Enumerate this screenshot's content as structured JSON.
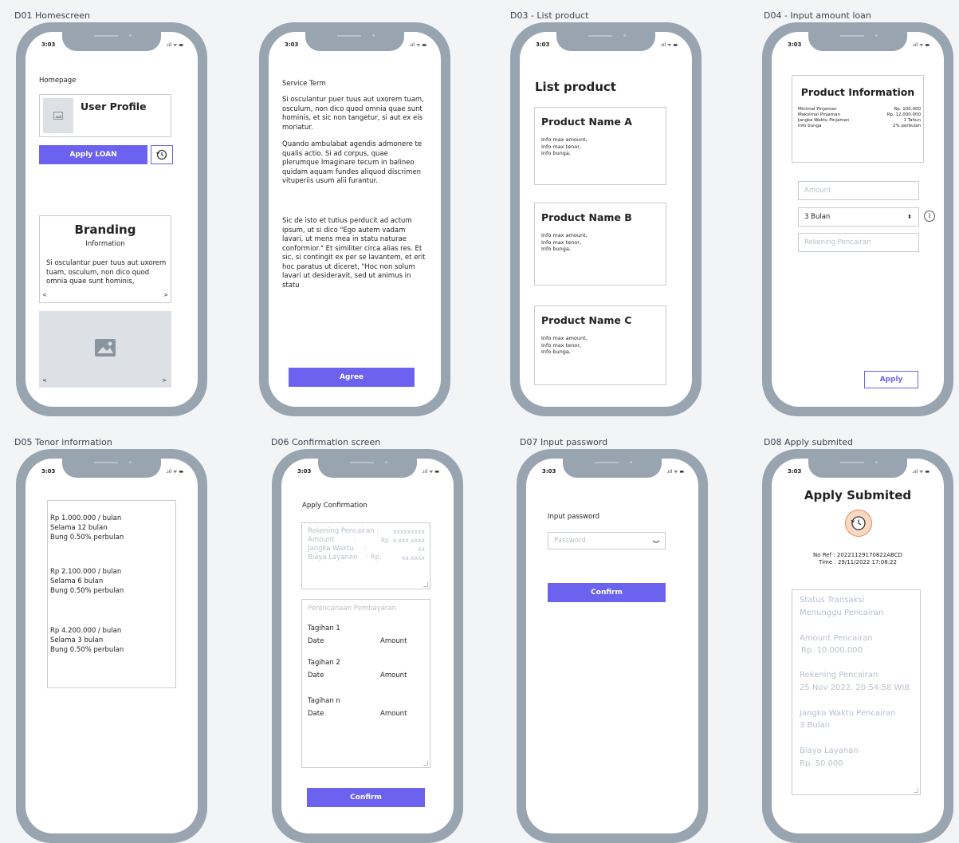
{
  "frames": {
    "d01": "D01 Homescreen",
    "d03": "D03 - List product",
    "d04": "D04 - Input amount loan",
    "d05": "D05 Tenor information",
    "d06": "D06 Confirmation screen",
    "d07": "D07 Input password",
    "d08": "D08 Apply submited"
  },
  "status": {
    "time": "3:03",
    "signal": ".ııl ᯤ ▬"
  },
  "d01": {
    "title": "Homepage",
    "profile": "User Profile",
    "apply_btn": "Apply LOAN",
    "history_icon": "history-icon",
    "branding_title": "Branding",
    "branding_sub": "Information",
    "branding_text": "Si osculantur puer tuus aut uxorem tuam, osculum, non dico quod omnia quae sunt hominis,",
    "prev": "<",
    "next": ">"
  },
  "d02": {
    "title": "Service Term",
    "p1": "Si osculantur puer tuus aut uxorem tuam, osculum, non dico quod omnia quae sunt hominis, et sic non tangetur, si aut ex eis moriatur.",
    "p2": "Quando ambulabat agendis admonere te qualis actio. Si ad corpus, quae plerumque Imaginare tecum in balineo quidam aquam fundes aliquod discrimen vituperiis usum alii furantur.",
    "p3": "Sic de isto et tutius perducit ad actum ipsum, ut si dico \"Ego autem vadam lavari, ut mens mea in statu naturae conformior.\" Et similiter circa alias res. Et sic, si contingit ex per se lavantem, et erit hoc paratus ut diceret, \"Hoc non solum lavari ut desideravit, sed ut animus in statu",
    "agree": "Agree"
  },
  "d03": {
    "title": "List product",
    "products": [
      {
        "name": "Product Name A",
        "l1": "Info max amount,",
        "l2": "Info max tenor,",
        "l3": "Info bunga,"
      },
      {
        "name": "Product Name B",
        "l1": "Info max amount,",
        "l2": "Info max tenor,",
        "l3": "Info bunga,"
      },
      {
        "name": "Product Name C",
        "l1": "Info max amount,",
        "l2": "Info max tenor,",
        "l3": "Info bunga,"
      }
    ]
  },
  "d04": {
    "title": "Product Information",
    "rows": [
      {
        "k": "Minimal Pinjaman",
        "v": "Rp. 100.000"
      },
      {
        "k": "Maksimal Pinjaman",
        "v": "Rp. 12,000.000"
      },
      {
        "k": "Jangka Waktu Pinjaman",
        "v": "1 Tahun"
      },
      {
        "k": "Info bunga",
        "v": "2% perbulan"
      }
    ],
    "amount_ph": "Amount",
    "tenor": "3 Bulan",
    "rek_ph": "Rekening Pencairan",
    "apply": "Apply"
  },
  "d05": {
    "items": [
      {
        "a": "Rp 1.000.000 / bulan",
        "b": "Selama 12 bulan",
        "c": "Bung 0.50% perbulan"
      },
      {
        "a": "Rp 2.100.000 / bulan",
        "b": "Selama 6 bulan",
        "c": "Bung 0.50% perbulan"
      },
      {
        "a": "Rp 4.200.000 / bulan",
        "b": "Selama 3 bulan",
        "c": "Bung 0.50% perbulan"
      }
    ]
  },
  "d06": {
    "title": "Apply Confirmation",
    "r1k": "Rekening Pencairan :",
    "r1v": "xxxxxxxxx",
    "r2k": "Amount         :",
    "r2v": "Rp. x.xxx.xxxx",
    "r3k": "Jangka Waktu     :",
    "r3v": "xx",
    "r4k": "Biaya Layanan    : Rp.",
    "r4v": "xx.xxxx",
    "plan_title": "Perencanaan Pembayaran",
    "bills": [
      {
        "t": "Tagihan 1",
        "d": "Date",
        "a": "Amount"
      },
      {
        "t": "Tagihan 2",
        "d": "Date",
        "a": "Amount"
      },
      {
        "t": "Tagihan n",
        "d": "Date",
        "a": "Amount"
      }
    ],
    "confirm": "Confirm"
  },
  "d07": {
    "title": "Input password",
    "ph": "Password",
    "confirm": "Confirm"
  },
  "d08": {
    "title": "Apply Submited",
    "ref": "No Ref : 20221129170822ABCD",
    "time": "Time : 29/11/2022 17:08:22",
    "s1": "Status Transaksi",
    "s1v": "Menunggu Pencairan",
    "s2": "Amount Pencairan",
    "s2v": "Rp. 10.000.000",
    "s3": "Rekening Pencairan",
    "s3v": "25 Nov 2022, 20:54:58 WIB",
    "s4": "Jangka Waktu Pencairan",
    "s4v": "3 Bulan",
    "s5": "Biaya Layanan",
    "s5v": "Rp. 50.000"
  }
}
